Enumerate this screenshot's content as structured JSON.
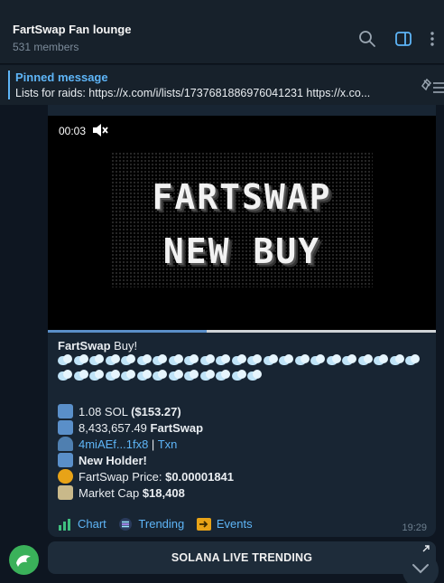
{
  "header": {
    "title": "FartSwap Fan lounge",
    "members": "531 members",
    "icons": [
      "search-icon",
      "sidebar-toggle-icon",
      "more-vertical-icon"
    ]
  },
  "pinned": {
    "title": "Pinned message",
    "text": "Lists for raids:  https://x.com/i/lists/1737681886976041231  https://x.co..."
  },
  "video": {
    "time": "00:03",
    "line1": "FARTSWAP",
    "line2": "NEW BUY",
    "progress": 0.41
  },
  "message": {
    "sender": "FartSwap",
    "intro": " Buy!",
    "sol_amount": "1.08 SOL ",
    "sol_usd": "($153.27)",
    "token_amount": "8,433,657.49 ",
    "token_name": "FartSwap",
    "wallet": "4miAEf...1fx8",
    "separator": " | ",
    "txn": "Txn",
    "new_holder": "New Holder!",
    "price_label": "FartSwap Price: ",
    "price_value": "$0.00001841",
    "mcap_label": "Market Cap ",
    "mcap_value": "$18,408",
    "time": "19:29"
  },
  "actions": {
    "chart": "Chart",
    "trending": "Trending",
    "events": "Events"
  },
  "button": {
    "label": "SOLANA LIVE TRENDING"
  },
  "colors": {
    "accent": "#5eb5f7",
    "background": "#0e1621",
    "header": "#17212b",
    "bubble": "#182533"
  }
}
